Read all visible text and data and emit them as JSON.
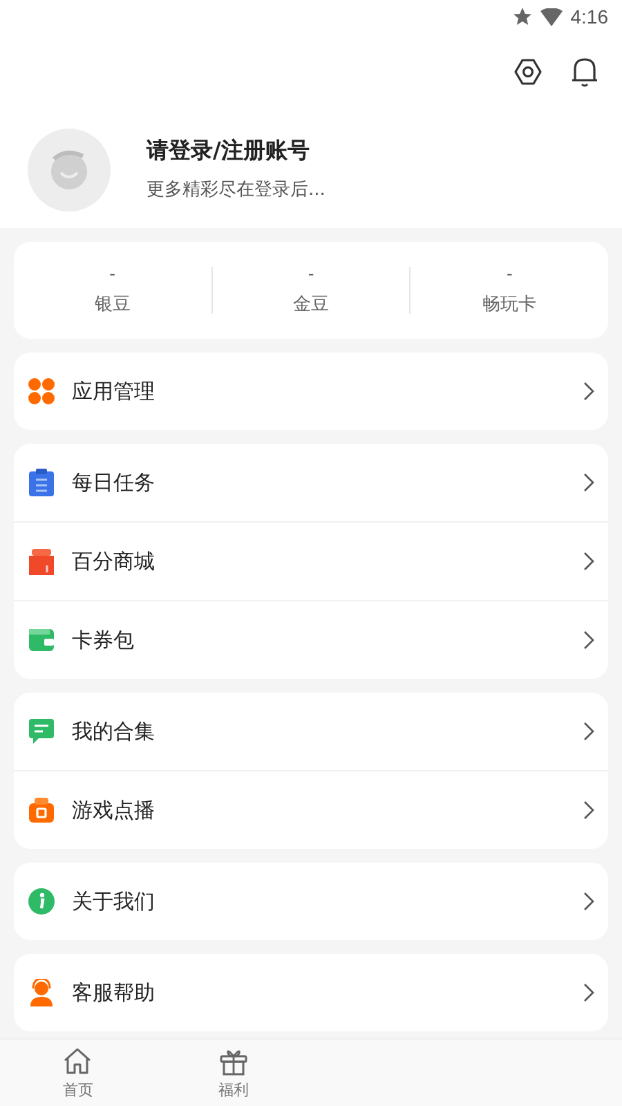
{
  "status_bar": {
    "time": "4:16"
  },
  "profile": {
    "title": "请登录/注册账号",
    "subtitle": "更多精彩尽在登录后..."
  },
  "stats": [
    {
      "value": "-",
      "label": "银豆"
    },
    {
      "value": "-",
      "label": "金豆"
    },
    {
      "value": "-",
      "label": "畅玩卡"
    }
  ],
  "menu_groups": [
    {
      "items": [
        {
          "kind": "apps",
          "label": "应用管理"
        }
      ]
    },
    {
      "items": [
        {
          "kind": "tasks",
          "label": "每日任务"
        },
        {
          "kind": "gift",
          "label": "百分商城"
        },
        {
          "kind": "wallet",
          "label": "卡券包"
        }
      ]
    },
    {
      "items": [
        {
          "kind": "chat",
          "label": "我的合集"
        },
        {
          "kind": "video",
          "label": "游戏点播"
        }
      ]
    },
    {
      "items": [
        {
          "kind": "info",
          "label": "关于我们"
        }
      ]
    },
    {
      "items": [
        {
          "kind": "support",
          "label": "客服帮助"
        }
      ]
    }
  ],
  "bottom_nav": [
    {
      "kind": "home",
      "label": "首页",
      "selected": false
    },
    {
      "kind": "gift",
      "label": "福利",
      "selected": false
    }
  ]
}
